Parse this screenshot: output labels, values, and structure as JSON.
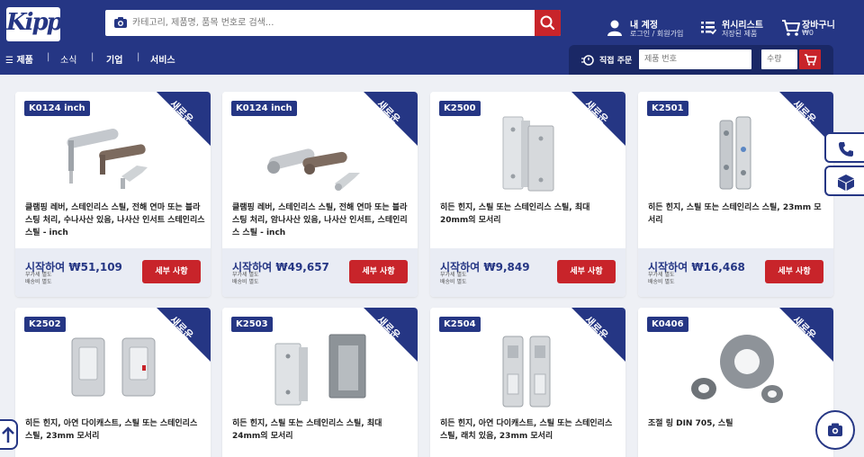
{
  "brand": {
    "logo_text": "Kipp",
    "accent": "#253684",
    "cta": "#c8242a"
  },
  "search": {
    "placeholder": "카테고리, 제품명, 품목 번호로 검색..."
  },
  "header_links": {
    "account": {
      "title": "내 계정",
      "sub": "로그인 / 회원가입"
    },
    "wishlist": {
      "title": "위시리스트",
      "sub": "저장된 제품"
    },
    "cart": {
      "title": "장바구니",
      "sub": "₩0"
    }
  },
  "nav": {
    "menu": "☰ 제품",
    "items": [
      "소식",
      "기업",
      "서비스"
    ],
    "separator": "|"
  },
  "quick_order": {
    "label": "직접 주문",
    "product_placeholder": "제품 번호",
    "qty_placeholder": "수량"
  },
  "product_labels": {
    "price_prefix": "시작하여",
    "tax_line1": "부가세 별도",
    "tax_line2": "배송비 별도",
    "detail_button": "세부 사항",
    "ribbon": "새로운"
  },
  "products": [
    {
      "sku": "K0124 inch",
      "title": "클램핑 레버, 스테인리스 스틸, 전해 연마 또는 블라스팅 처리, 수나사산 있음, 나사산 인서트 스테인리스 스틸 - inch",
      "price": "₩51,109"
    },
    {
      "sku": "K0124 inch",
      "title": "클램핑 레버, 스테인리스 스틸, 전해 연마 또는 블라스팅 처리, 암나사산 있음, 나사산 인서트, 스테인리스 스틸 - inch",
      "price": "₩49,657"
    },
    {
      "sku": "K2500",
      "title": "히든 힌지, 스틸 또는 스테인리스 스틸, 최대 20mm의 모서리",
      "price": "₩9,849"
    },
    {
      "sku": "K2501",
      "title": "히든 힌지, 스틸 또는 스테인리스 스틸, 23mm 모서리",
      "price": "₩16,468"
    },
    {
      "sku": "K2502",
      "title": "히든 힌지, 아연 다이캐스트, 스틸 또는 스테인리스 스틸, 23mm 모서리",
      "price": ""
    },
    {
      "sku": "K2503",
      "title": "히든 힌지, 스틸 또는 스테인리스 스틸, 최대 24mm의 모서리",
      "price": ""
    },
    {
      "sku": "K2504",
      "title": "히든 힌지, 아연 다이캐스트, 스틸 또는 스테인리스 스틸, 래치 있음, 23mm 모서리",
      "price": ""
    },
    {
      "sku": "K0406",
      "title": "조절 링 DIN 705, 스틸",
      "price": ""
    }
  ]
}
